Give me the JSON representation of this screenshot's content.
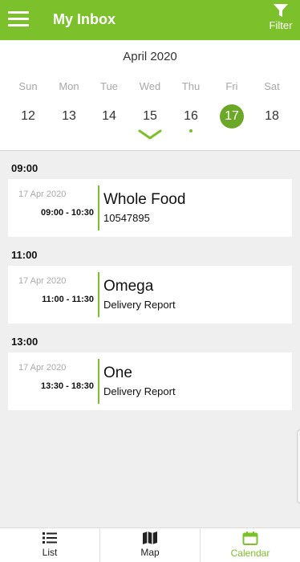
{
  "app_bar": {
    "title": "My Inbox",
    "filter_label": "Filter"
  },
  "calendar": {
    "month": "April 2020",
    "days": [
      {
        "dow": "Sun",
        "num": "12"
      },
      {
        "dow": "Mon",
        "num": "13"
      },
      {
        "dow": "Tue",
        "num": "14"
      },
      {
        "dow": "Wed",
        "num": "15"
      },
      {
        "dow": "Thu",
        "num": "16"
      },
      {
        "dow": "Fri",
        "num": "17"
      },
      {
        "dow": "Sat",
        "num": "18"
      }
    ],
    "selected_day": "17",
    "event_dot_day": "16"
  },
  "schedule": [
    {
      "time": "09:00",
      "card": {
        "date": "17 Apr 2020",
        "range": "09:00 - 10:30",
        "title": "Whole Food",
        "subtitle": "10547895"
      }
    },
    {
      "time": "11:00",
      "card": {
        "date": "17 Apr 2020",
        "range": "11:00 - 11:30",
        "title": "Omega",
        "subtitle": "Delivery Report"
      }
    },
    {
      "time": "13:00",
      "card": {
        "date": "17 Apr 2020",
        "range": "13:30 - 18:30",
        "title": "One",
        "subtitle": "Delivery Report"
      }
    }
  ],
  "bottom_nav": {
    "items": [
      {
        "label": "List",
        "icon": "list-icon"
      },
      {
        "label": "Map",
        "icon": "map-icon"
      },
      {
        "label": "Calendar",
        "icon": "calendar-icon"
      }
    ],
    "active": "Calendar"
  },
  "colors": {
    "accent": "#7cc12b",
    "selected_day": "#6ba828",
    "background": "#efefef"
  }
}
